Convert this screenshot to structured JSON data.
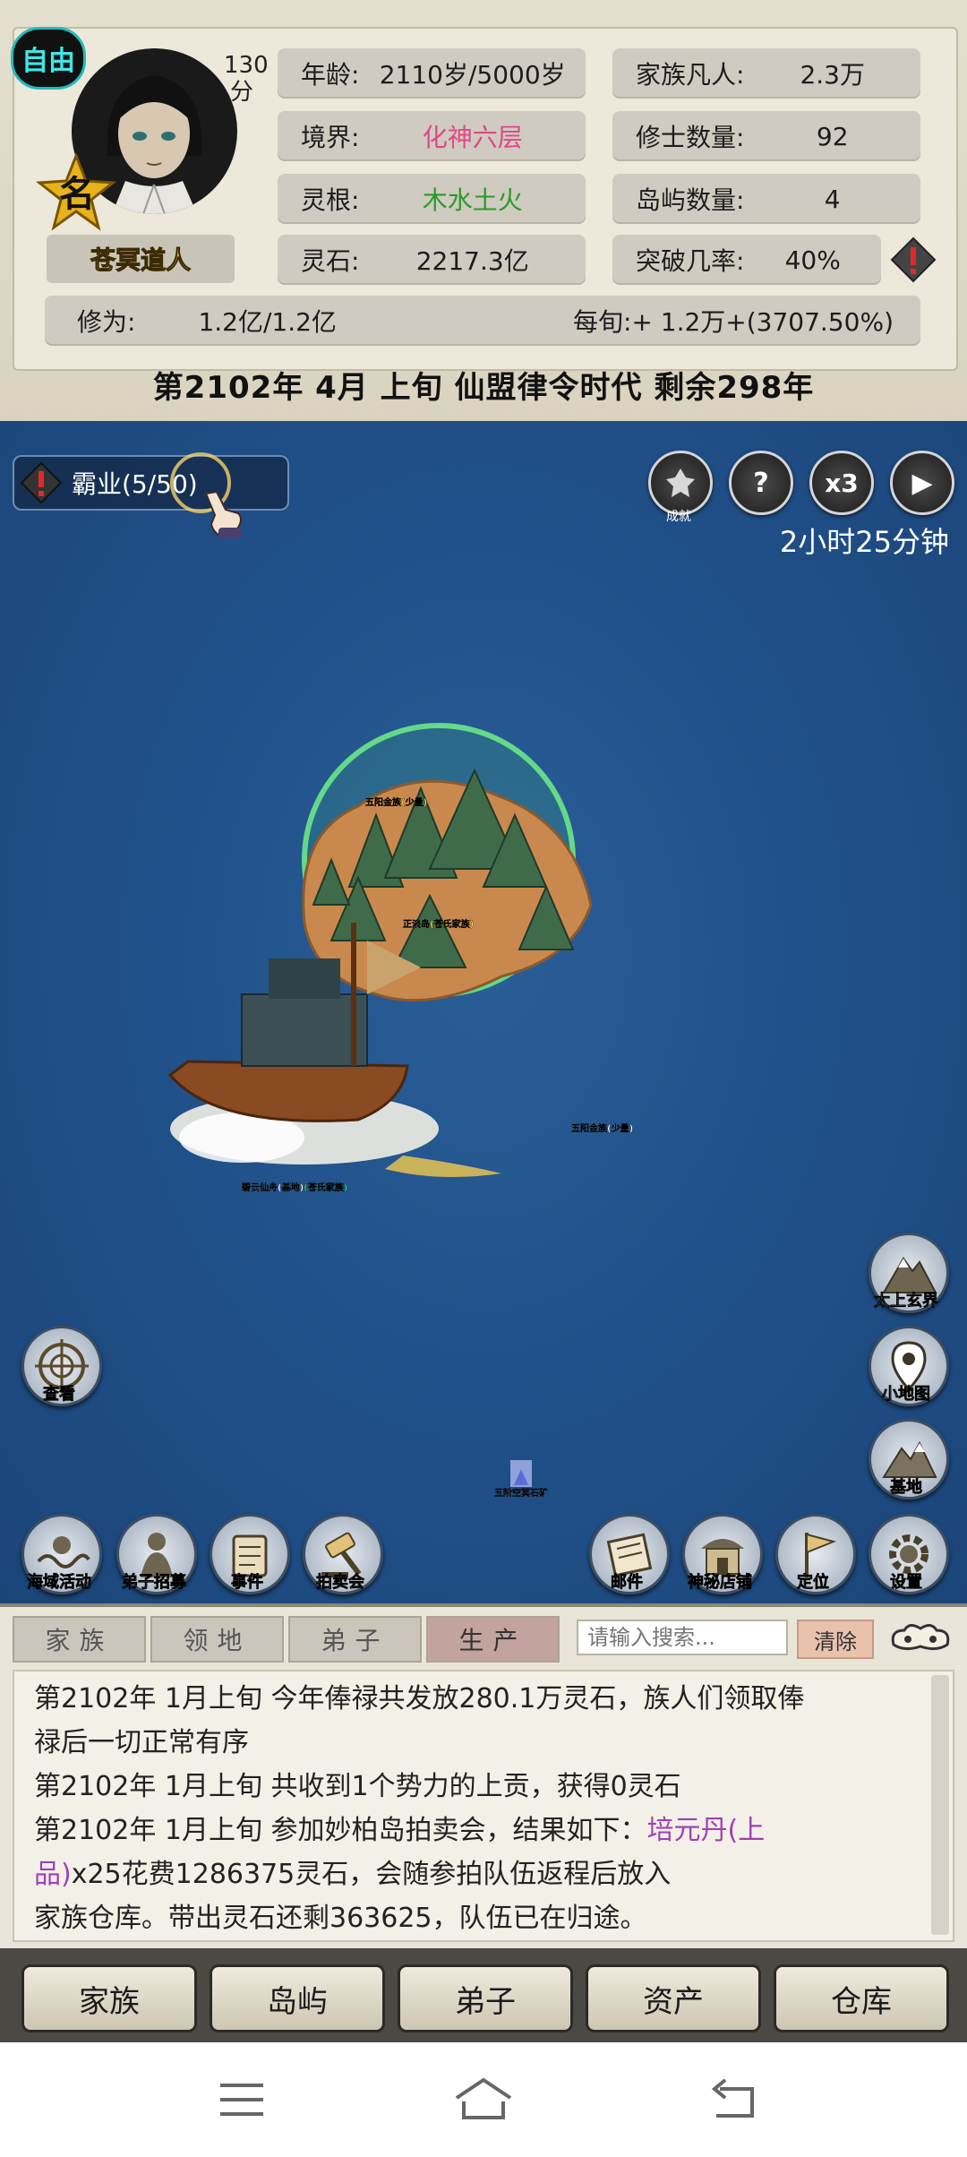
{
  "profile": {
    "free_badge": "自由",
    "score": "130",
    "score_unit": "分",
    "name_badge": "名",
    "name": "苍冥道人"
  },
  "stats": {
    "age_label": "年龄:",
    "age_value": "2110岁/5000岁",
    "realm_label": "境界:",
    "realm_value": "化神六层",
    "root_label": "灵根:",
    "root_value": "木水土火",
    "stone_label": "灵石:",
    "stone_value": "2217.3亿",
    "mortals_label": "家族凡人:",
    "mortals_value": "2.3万",
    "cultivators_label": "修士数量:",
    "cultivators_value": "92",
    "islands_label": "岛屿数量:",
    "islands_value": "4",
    "breakthrough_label": "突破几率:",
    "breakthrough_value": "40%",
    "cultivation_label": "修为:",
    "cultivation_value": "1.2亿/1.2亿",
    "per_period": "每旬:+ 1.2万+(3707.50%)"
  },
  "era": "第2102年 4月 上旬  仙盟律令时代 剩余298年",
  "map": {
    "hegemony": "霸业(5/50)",
    "top_buttons": [
      "成就",
      "?",
      "x3",
      "▶"
    ],
    "timer": "2小时25分钟",
    "island_labels": {
      "north": "五阳金族(少量)",
      "island_name": "正淡岛",
      "island_owner": "(苍氏家族)",
      "east": "五阳金族(少量)",
      "ship_name": "碧云仙舟(基地)",
      "ship_owner": "(苍氏家族)",
      "mine": "五阶空冥石矿"
    },
    "left_buttons": [
      {
        "label": "查看",
        "icon": "crosshair-icon"
      }
    ],
    "right_buttons": [
      {
        "label": "太上玄界",
        "icon": "mountain-icon"
      },
      {
        "label": "小地图",
        "icon": "map-pin-icon"
      },
      {
        "label": "基地",
        "icon": "mountain-base-icon"
      }
    ],
    "bottom_left_buttons": [
      {
        "label": "海域活动",
        "icon": "sea-icon"
      },
      {
        "label": "弟子招募",
        "icon": "disciple-icon"
      },
      {
        "label": "事件",
        "icon": "scroll-icon"
      },
      {
        "label": "拍卖会",
        "icon": "gavel-icon"
      }
    ],
    "bottom_right_buttons": [
      {
        "label": "邮件",
        "icon": "mail-icon"
      },
      {
        "label": "神秘店铺",
        "icon": "shop-icon"
      },
      {
        "label": "定位",
        "icon": "flag-icon"
      },
      {
        "label": "设置",
        "icon": "gear-icon"
      }
    ]
  },
  "log": {
    "tabs": [
      "家族",
      "领地",
      "弟子",
      "生产"
    ],
    "search_placeholder": "请输入搜索...",
    "clear": "清除",
    "entries": [
      {
        "prefix": "第2102年 1月上旬 今年俸禄共发放280.1万灵石，族人们领取俸",
        "cont": "禄后一切正常有序"
      },
      {
        "prefix": "第2102年 1月上旬 共收到1个势力的上贡，获得0灵石"
      },
      {
        "prefix": "第2102年 1月上旬 参加妙柏岛拍卖会，结果如下：",
        "highlight": "培元丹(上",
        "highlight2": "品)",
        "rest": "x25花费1286375灵石，会随参拍队伍返程后放入",
        "cont": "家族仓库。带出灵石还剩363625，队伍已在归途。"
      }
    ]
  },
  "bottom_nav": [
    "家族",
    "岛屿",
    "弟子",
    "资产",
    "仓库"
  ],
  "colors": {
    "realm": "#e0478a",
    "root": "#2b9a2b",
    "item_highlight": "#a03fb5",
    "sea": "#21518a"
  }
}
